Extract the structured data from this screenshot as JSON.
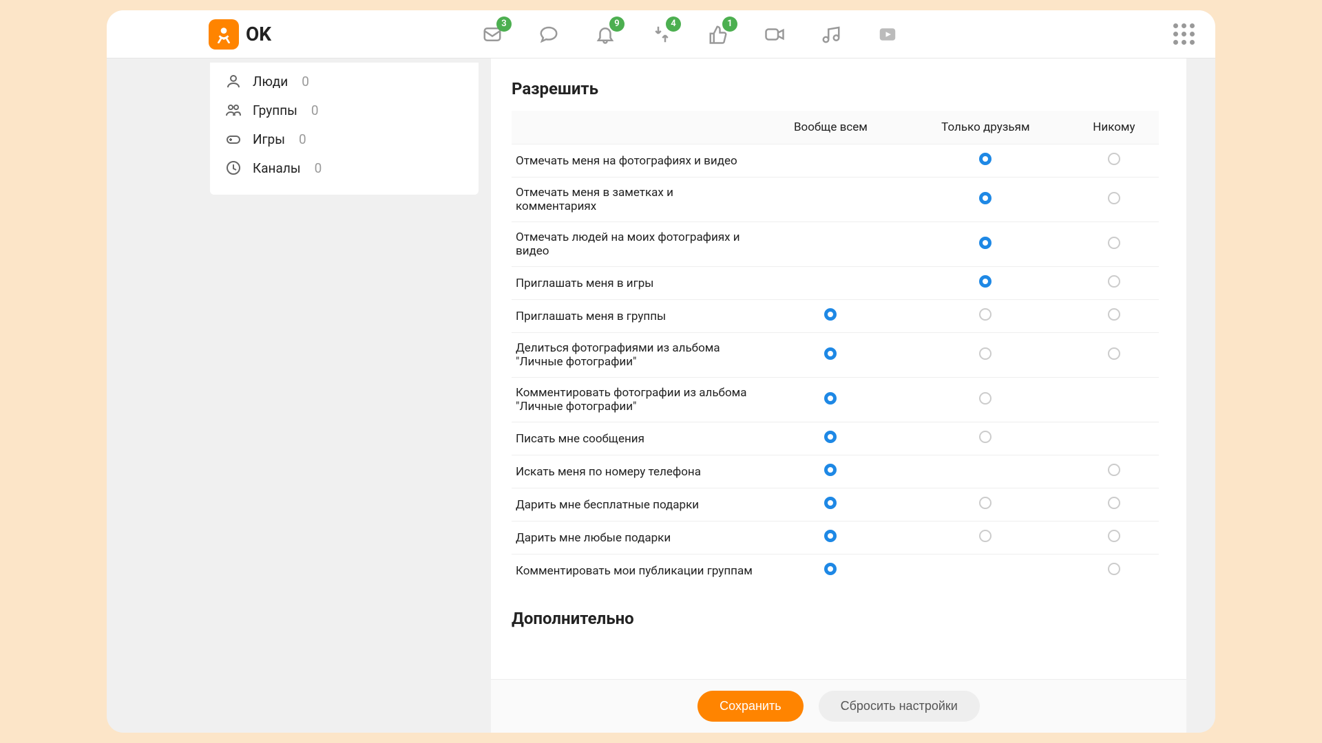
{
  "brand": {
    "name": "OK"
  },
  "nav": {
    "badges": {
      "messages": "3",
      "notifications": "9",
      "feed": "4",
      "likes": "1"
    }
  },
  "sidebar": {
    "items": [
      {
        "label": "Люди",
        "count": "0"
      },
      {
        "label": "Группы",
        "count": "0"
      },
      {
        "label": "Игры",
        "count": "0"
      },
      {
        "label": "Каналы",
        "count": "0"
      }
    ]
  },
  "permissions": {
    "title": "Разрешить",
    "columns": {
      "all": "Вообще всем",
      "friends": "Только друзьям",
      "none": "Никому"
    },
    "rows": [
      {
        "label": "Отмечать меня на фотографиях и видео",
        "selected": "friends",
        "options": [
          "friends",
          "none"
        ]
      },
      {
        "label": "Отмечать меня в заметках и комментариях",
        "selected": "friends",
        "options": [
          "friends",
          "none"
        ]
      },
      {
        "label": "Отмечать людей на моих фотографиях и видео",
        "selected": "friends",
        "options": [
          "friends",
          "none"
        ]
      },
      {
        "label": "Приглашать меня в игры",
        "selected": "friends",
        "options": [
          "friends",
          "none"
        ]
      },
      {
        "label": "Приглашать меня в группы",
        "selected": "all",
        "options": [
          "all",
          "friends",
          "none"
        ]
      },
      {
        "label": "Делиться фотографиями из альбома \"Личные фотографии\"",
        "selected": "all",
        "options": [
          "all",
          "friends",
          "none"
        ]
      },
      {
        "label": "Комментировать фотографии из альбома \"Личные фотографии\"",
        "selected": "all",
        "options": [
          "all",
          "friends"
        ]
      },
      {
        "label": "Писать мне сообщения",
        "selected": "all",
        "options": [
          "all",
          "friends"
        ]
      },
      {
        "label": "Искать меня по номеру телефона",
        "selected": "all",
        "options": [
          "all",
          "none"
        ]
      },
      {
        "label": "Дарить мне бесплатные подарки",
        "selected": "all",
        "options": [
          "all",
          "friends",
          "none"
        ]
      },
      {
        "label": "Дарить мне любые подарки",
        "selected": "all",
        "options": [
          "all",
          "friends",
          "none"
        ]
      },
      {
        "label": "Комментировать мои публикации группам",
        "selected": "all",
        "options": [
          "all",
          "none"
        ]
      }
    ]
  },
  "additional": {
    "title": "Дополнительно"
  },
  "footer": {
    "save": "Сохранить",
    "reset": "Сбросить настройки"
  }
}
